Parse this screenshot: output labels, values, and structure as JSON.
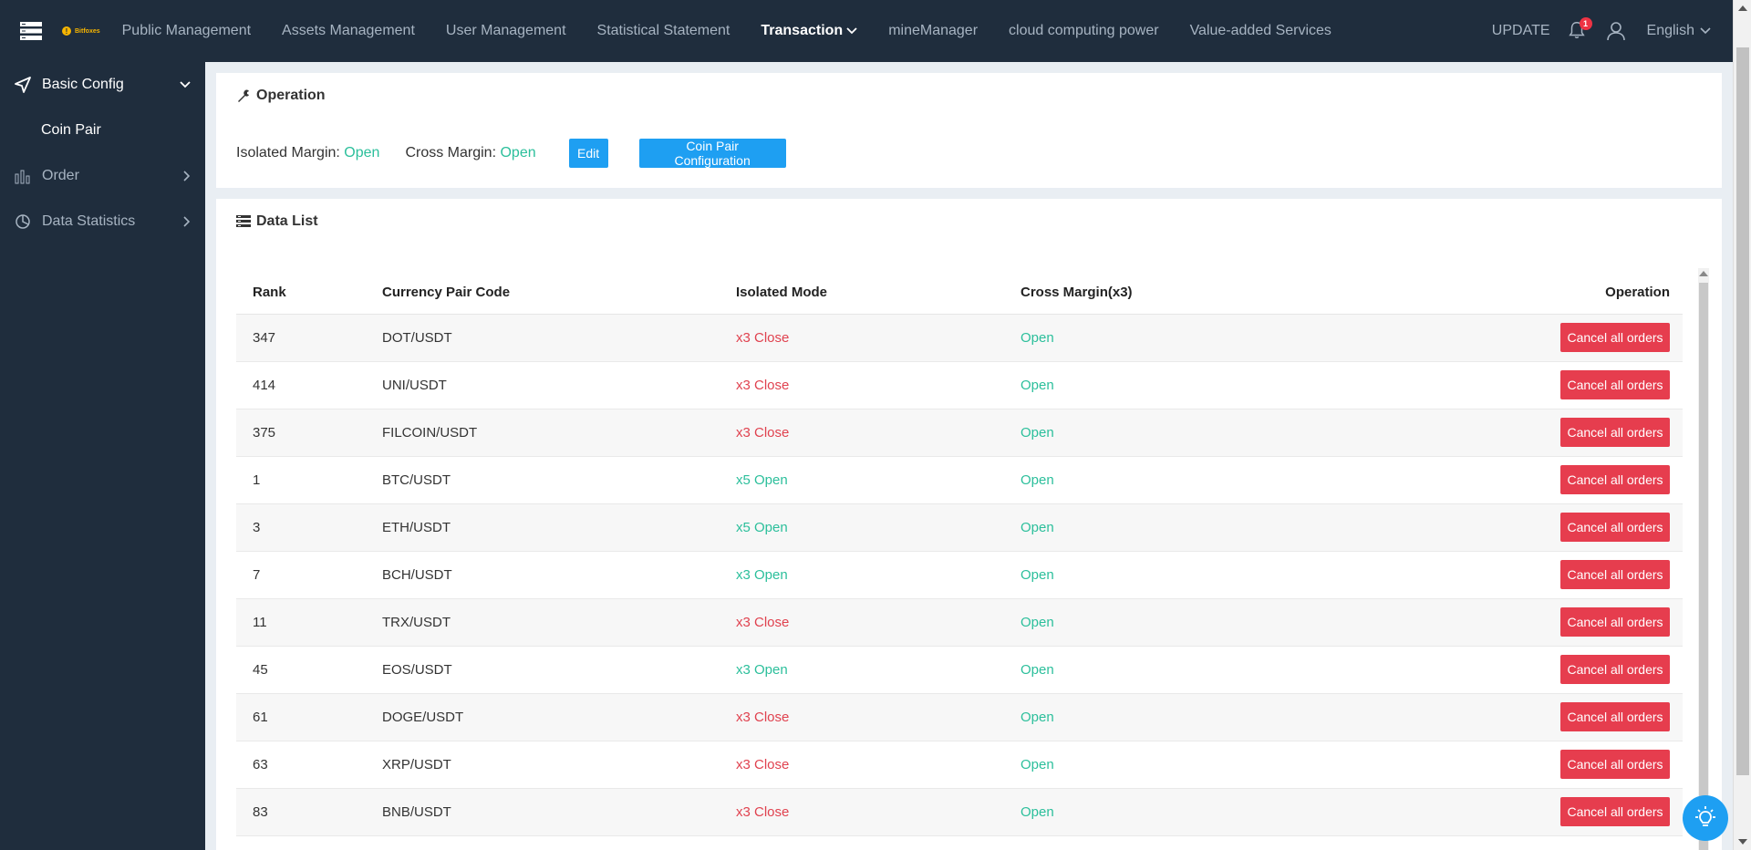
{
  "header": {
    "logo_text": "Bitfoxes",
    "nav": [
      {
        "label": "Public Management"
      },
      {
        "label": "Assets Management"
      },
      {
        "label": "User Management"
      },
      {
        "label": "Statistical Statement"
      },
      {
        "label": "Transaction"
      },
      {
        "label": "mineManager"
      },
      {
        "label": "cloud computing power"
      },
      {
        "label": "Value-added Services"
      }
    ],
    "update_label": "UPDATE",
    "notification_count": "1",
    "language": "English"
  },
  "sidebar": {
    "items": [
      {
        "label": "Basic Config",
        "icon": "send-icon"
      },
      {
        "label": "Coin Pair"
      },
      {
        "label": "Order",
        "icon": "bar-chart-icon"
      },
      {
        "label": "Data Statistics",
        "icon": "pie-chart-icon"
      }
    ]
  },
  "operation": {
    "title": "Operation",
    "isolated_label": "Isolated Margin:",
    "isolated_value": "Open",
    "cross_label": "Cross Margin:",
    "cross_value": "Open",
    "edit_button": "Edit",
    "config_button": "Coin Pair Configuration"
  },
  "list": {
    "title": "Data List",
    "columns": [
      "Rank",
      "Currency Pair Code",
      "Isolated Mode",
      "Cross Margin(x3)",
      "Operation"
    ],
    "action_label": "Cancel all orders",
    "rows": [
      {
        "rank": "347",
        "pair": "DOT/USDT",
        "isolated": "x3 Close",
        "cross": "Open"
      },
      {
        "rank": "414",
        "pair": "UNI/USDT",
        "isolated": "x3 Close",
        "cross": "Open"
      },
      {
        "rank": "375",
        "pair": "FILCOIN/USDT",
        "isolated": "x3 Close",
        "cross": "Open"
      },
      {
        "rank": "1",
        "pair": "BTC/USDT",
        "isolated": "x5 Open",
        "cross": "Open"
      },
      {
        "rank": "3",
        "pair": "ETH/USDT",
        "isolated": "x5 Open",
        "cross": "Open"
      },
      {
        "rank": "7",
        "pair": "BCH/USDT",
        "isolated": "x3 Open",
        "cross": "Open"
      },
      {
        "rank": "11",
        "pair": "TRX/USDT",
        "isolated": "x3 Close",
        "cross": "Open"
      },
      {
        "rank": "45",
        "pair": "EOS/USDT",
        "isolated": "x3 Open",
        "cross": "Open"
      },
      {
        "rank": "61",
        "pair": "DOGE/USDT",
        "isolated": "x3 Close",
        "cross": "Open"
      },
      {
        "rank": "63",
        "pair": "XRP/USDT",
        "isolated": "x3 Close",
        "cross": "Open"
      },
      {
        "rank": "83",
        "pair": "BNB/USDT",
        "isolated": "x3 Close",
        "cross": "Open"
      }
    ]
  },
  "colors": {
    "nav_bg": "#1f2d3d",
    "primary": "#1e9ff2",
    "danger": "#e63d4e",
    "open_green": "#2bbf9b",
    "close_red": "#e0424f"
  }
}
